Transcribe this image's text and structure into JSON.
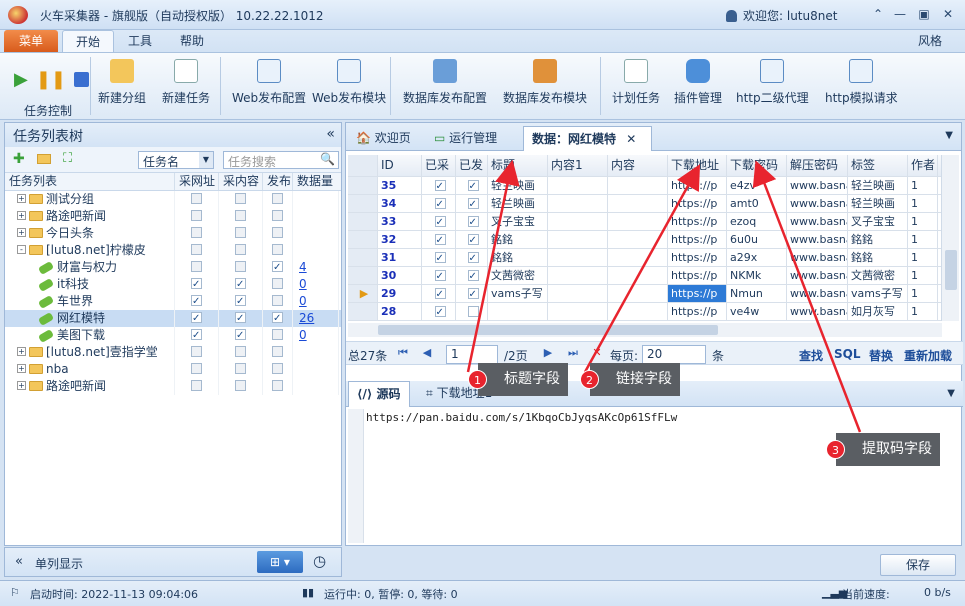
{
  "app": {
    "title": "火车采集器 - 旗舰版（自动授权版） 10.22.22.1012",
    "welcome": "欢迎您: lutu8net",
    "style_label": "风格"
  },
  "menu_tabs": [
    "菜单",
    "开始",
    "工具",
    "帮助"
  ],
  "ribbon": {
    "group_label": "任务控制",
    "buttons": [
      "新建分组",
      "新建任务",
      "Web发布配置",
      "Web发布模块",
      "数据库发布配置",
      "数据库发布模块",
      "计划任务",
      "插件管理",
      "http二级代理",
      "http模拟请求"
    ]
  },
  "left_panel": {
    "title": "任务列表树",
    "filter_select": "任务名",
    "search_placeholder": "任务搜索",
    "columns": [
      "任务列表",
      "采网址",
      "采内容",
      "发布",
      "数据量"
    ],
    "rows": [
      {
        "name": "测试分组",
        "type": "folder",
        "level": 0,
        "expand": "+",
        "c1": false,
        "c2": false,
        "c3": false,
        "count": ""
      },
      {
        "name": "路途吧新闻",
        "type": "folder",
        "level": 0,
        "expand": "+",
        "c1": false,
        "c2": false,
        "c3": false,
        "count": ""
      },
      {
        "name": "今日头条",
        "type": "folder",
        "level": 0,
        "expand": "+",
        "c1": false,
        "c2": false,
        "c3": false,
        "count": ""
      },
      {
        "name": "[lutu8.net]柠檬皮",
        "type": "folder",
        "level": 0,
        "expand": "-",
        "c1": false,
        "c2": false,
        "c3": false,
        "count": ""
      },
      {
        "name": "财富与权力",
        "type": "task",
        "level": 1,
        "c1": false,
        "c2": false,
        "c3": true,
        "count": "4"
      },
      {
        "name": "it科技",
        "type": "task",
        "level": 1,
        "c1": true,
        "c2": true,
        "c3": false,
        "count": "0"
      },
      {
        "name": "车世界",
        "type": "task",
        "level": 1,
        "c1": true,
        "c2": true,
        "c3": false,
        "count": "0"
      },
      {
        "name": "网红模特",
        "type": "task",
        "level": 1,
        "c1": true,
        "c2": true,
        "c3": true,
        "count": "26",
        "selected": true
      },
      {
        "name": "美图下载",
        "type": "task",
        "level": 1,
        "c1": true,
        "c2": true,
        "c3": false,
        "count": "0"
      },
      {
        "name": "[lutu8.net]壹指学堂",
        "type": "folder",
        "level": 0,
        "expand": "+",
        "c1": false,
        "c2": false,
        "c3": false,
        "count": ""
      },
      {
        "name": "nba",
        "type": "folder",
        "level": 0,
        "expand": "+",
        "c1": false,
        "c2": false,
        "c3": false,
        "count": ""
      },
      {
        "name": "路途吧新闻",
        "type": "folder",
        "level": 0,
        "expand": "+",
        "c1": false,
        "c2": false,
        "c3": false,
        "count": ""
      }
    ],
    "footer_label": "单列显示"
  },
  "content_tabs": [
    "欢迎页",
    "运行管理",
    "数据：网红模特"
  ],
  "grid": {
    "columns": [
      "ID",
      "已采",
      "已发",
      "标题",
      "内容1",
      "内容",
      "下载地址",
      "下载密码",
      "解压密码",
      "标签",
      "作者"
    ],
    "rows": [
      {
        "id": "35",
        "a": true,
        "b": true,
        "title": "轻兰映画",
        "c1": "",
        "c": "",
        "url": "https://p",
        "pwd": "e4zv",
        "unzip": "www.basna",
        "tag": "轻兰映画",
        "author": "1"
      },
      {
        "id": "34",
        "a": true,
        "b": true,
        "title": "轻兰映画",
        "c1": "",
        "c": "",
        "url": "https://p",
        "pwd": "amt0",
        "unzip": "www.basna",
        "tag": "轻兰映画",
        "author": "1"
      },
      {
        "id": "33",
        "a": true,
        "b": true,
        "title": "叉子宝宝",
        "c1": "",
        "c": "",
        "url": "https://p",
        "pwd": "ezoq",
        "unzip": "www.basna",
        "tag": "叉子宝宝",
        "author": "1"
      },
      {
        "id": "32",
        "a": true,
        "b": true,
        "title": "銘銘",
        "c1": "",
        "c": "",
        "url": "https://p",
        "pwd": "6u0u",
        "unzip": "www.basna",
        "tag": "銘銘",
        "author": "1"
      },
      {
        "id": "31",
        "a": true,
        "b": true,
        "title": "銘銘",
        "c1": "",
        "c": "",
        "url": "https://p",
        "pwd": "a29x",
        "unzip": "www.basna",
        "tag": "銘銘",
        "author": "1"
      },
      {
        "id": "30",
        "a": true,
        "b": true,
        "title": "文茜微密",
        "c1": "",
        "c": "",
        "url": "https://p",
        "pwd": "NKMk",
        "unzip": "www.basna",
        "tag": "文茜微密",
        "author": "1"
      },
      {
        "id": "29",
        "a": true,
        "b": true,
        "title": "vams子写",
        "c1": "",
        "c": "",
        "url": "https://p",
        "pwd": "Nmun",
        "unzip": "www.basna",
        "tag": "vams子写",
        "author": "1",
        "current": true
      },
      {
        "id": "28",
        "a": true,
        "b": false,
        "title": "",
        "c1": "",
        "c": "",
        "url": "https://p",
        "pwd": "ve4w",
        "unzip": "www.basna",
        "tag": "如月灰写",
        "author": "1"
      }
    ]
  },
  "pager": {
    "total": "总27条",
    "page_value": "1",
    "page_of": "/2页",
    "per_page_label": "每页:",
    "per_page_value": "20",
    "unit": "条",
    "find": "查找",
    "sql": "SQL",
    "replace": "替换",
    "reload": "重新加载"
  },
  "bottom_tabs": [
    "源码",
    "下载地址1"
  ],
  "source_text": "https://pan.baidu.com/s/1KbqoCbJyqsAKcOp61SfFLw",
  "callouts": [
    {
      "num": "1",
      "text": "标题字段"
    },
    {
      "num": "2",
      "text": "链接字段"
    },
    {
      "num": "3",
      "text": "提取码字段"
    }
  ],
  "save_label": "保存",
  "status": {
    "start": "启动时间:  2022-11-13 09:04:06",
    "running": "运行中: 0,  暂停: 0,  等待: 0",
    "speed_label": "当前速度:",
    "speed": "0 b/s"
  },
  "colors": {
    "accent": "#e8242e",
    "tab_orange": "#e06a2a",
    "callout_bg": "#5a5e63"
  }
}
